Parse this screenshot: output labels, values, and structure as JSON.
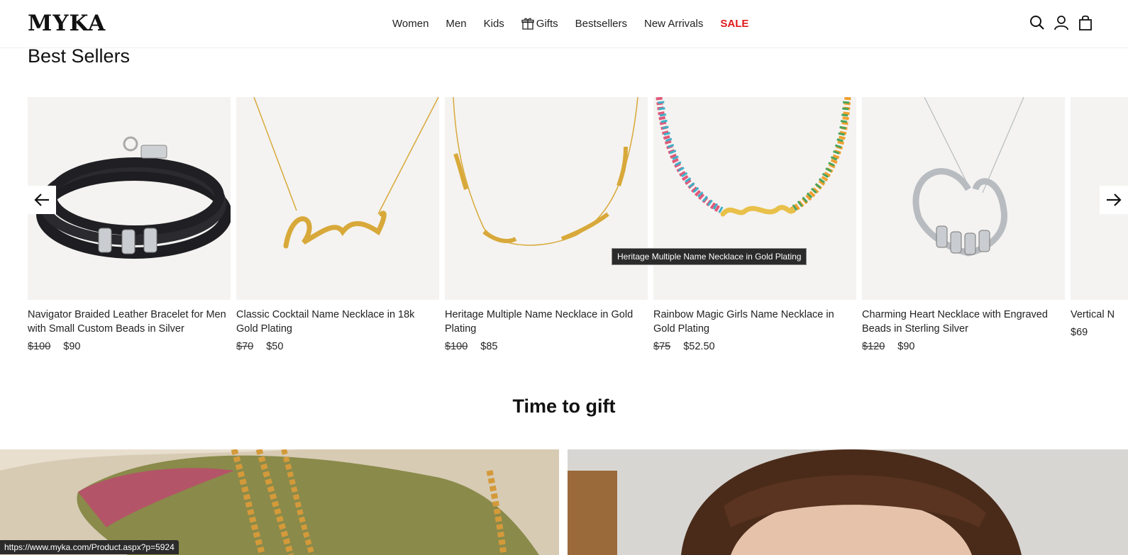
{
  "header": {
    "logo": "MYKA",
    "nav": [
      {
        "label": "Women",
        "name": "nav-women"
      },
      {
        "label": "Men",
        "name": "nav-men"
      },
      {
        "label": "Kids",
        "name": "nav-kids"
      },
      {
        "label": "Gifts",
        "name": "nav-gifts",
        "icon": "gift-icon"
      },
      {
        "label": "Bestsellers",
        "name": "nav-bestsellers"
      },
      {
        "label": "New Arrivals",
        "name": "nav-new-arrivals"
      },
      {
        "label": "SALE",
        "name": "nav-sale",
        "color": "#e01b1b"
      }
    ],
    "icons": [
      "search-icon",
      "account-icon",
      "shopping-bag-icon"
    ]
  },
  "best_sellers": {
    "title": "Best Sellers",
    "products": [
      {
        "name": "Navigator Braided Leather Bracelet for Men with Small Custom Beads in Silver",
        "old_price": "$100",
        "price": "$90"
      },
      {
        "name": "Classic Cocktail Name Necklace in 18k Gold Plating",
        "old_price": "$70",
        "price": "$50"
      },
      {
        "name": "Heritage Multiple Name Necklace in Gold Plating",
        "old_price": "$100",
        "price": "$85"
      },
      {
        "name": "Rainbow Magic Girls Name Necklace in Gold Plating",
        "old_price": "$75",
        "price": "$52.50"
      },
      {
        "name": "Charming Heart Necklace with Engraved Beads in Sterling Silver",
        "old_price": "$120",
        "price": "$90"
      },
      {
        "name": "Vertical N",
        "old_price": "",
        "price": "$69"
      }
    ],
    "tooltip": "Heritage Multiple Name Necklace in Gold Plating",
    "prev_icon": "arrow-left-icon",
    "next_icon": "arrow-right-icon"
  },
  "gift_section": {
    "title": "Time to gift"
  },
  "status_bar": {
    "url": "https://www.myka.com/Product.aspx?p=5924"
  },
  "colors": {
    "accent_sale": "#e01b1b",
    "image_bg": "#f4f3f1",
    "gold": "#d8a93a",
    "silver": "#b8bcc0"
  }
}
